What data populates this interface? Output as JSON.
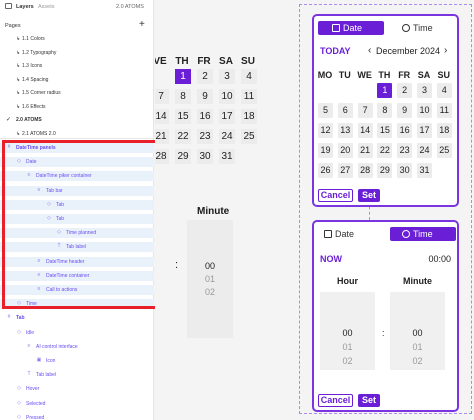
{
  "tabs": {
    "layers": "Layers",
    "assets": "Assets",
    "atoms": "2.0 ATOMS"
  },
  "pages": {
    "header": "Pages",
    "add": "+",
    "items": [
      {
        "label": "1.1 Colors"
      },
      {
        "label": "1.2 Typography"
      },
      {
        "label": "1.3 Icons"
      },
      {
        "label": "1.4 Spacing"
      },
      {
        "label": "1.5 Corner radius"
      },
      {
        "label": "1.6 Effects"
      },
      {
        "label": "2.0 ATOMS"
      },
      {
        "label": "2.1 ATOMS 2.0"
      }
    ],
    "current_mark": "✓"
  },
  "layers": [
    {
      "label": "DateTime panels",
      "icon": "#",
      "indent": 6,
      "sel": true,
      "bold": true
    },
    {
      "label": "Date",
      "icon": "◇",
      "indent": 16,
      "sel": true
    },
    {
      "label": "DateTime piker container",
      "icon": "≡",
      "indent": 26,
      "sel": true
    },
    {
      "label": "Tab bar",
      "icon": "≡",
      "indent": 36,
      "sel": true
    },
    {
      "label": "Tab",
      "icon": "◇",
      "indent": 46,
      "sel": true
    },
    {
      "label": "Tab",
      "icon": "◇",
      "indent": 46,
      "sel": true
    },
    {
      "label": "Time planned",
      "icon": "◇",
      "indent": 56,
      "sel": true
    },
    {
      "label": "Tab label",
      "icon": "T",
      "indent": 56,
      "sel": true
    },
    {
      "label": "DateTime header",
      "icon": "≡",
      "indent": 36,
      "sel": true
    },
    {
      "label": "DateTime container",
      "icon": "≡",
      "indent": 36,
      "sel": true
    },
    {
      "label": "Call to actions",
      "icon": "≡",
      "indent": 36,
      "sel": true
    },
    {
      "label": "Time",
      "icon": "◇",
      "indent": 16,
      "sel": true
    },
    {
      "label": "Tab",
      "icon": "#",
      "indent": 6,
      "sel": false,
      "bold": true
    },
    {
      "label": "Idle",
      "icon": "◇",
      "indent": 16,
      "sel": false
    },
    {
      "label": "AI control interface",
      "icon": "≡",
      "indent": 26,
      "sel": false
    },
    {
      "label": "Icon",
      "icon": "▣",
      "indent": 36,
      "sel": false
    },
    {
      "label": "Tab label",
      "icon": "T",
      "indent": 26,
      "sel": false
    },
    {
      "label": "Hover",
      "icon": "◇",
      "indent": 16,
      "sel": false
    },
    {
      "label": "Selected",
      "icon": "◇",
      "indent": 16,
      "sel": false
    },
    {
      "label": "Pressed",
      "icon": "◇",
      "indent": 16,
      "sel": false
    }
  ],
  "bg_calendar": {
    "heads": [
      "VE",
      "TH",
      "FR",
      "SA",
      "SU"
    ],
    "rows": [
      [
        "",
        "1",
        "2",
        "3",
        "4"
      ],
      [
        "7",
        "8",
        "9",
        "10",
        "11"
      ],
      [
        "14",
        "15",
        "16",
        "17",
        "18"
      ],
      [
        "21",
        "22",
        "23",
        "24",
        "25"
      ],
      [
        "28",
        "29",
        "30",
        "31",
        ""
      ]
    ],
    "minute_label": "Minute",
    "minute_values": [
      "00",
      "01",
      "02"
    ],
    "colon": ":"
  },
  "date_picker": {
    "tab_date": "Date",
    "tab_time": "Time",
    "today": "TODAY",
    "prev": "‹",
    "month": "December 2024",
    "next": "›",
    "weekdays": [
      "MO",
      "TU",
      "WE",
      "TH",
      "FR",
      "SA",
      "SU"
    ],
    "weeks": [
      [
        "",
        "",
        "",
        "1",
        "2",
        "3",
        "4"
      ],
      [
        "5",
        "6",
        "7",
        "8",
        "9",
        "10",
        "11"
      ],
      [
        "12",
        "13",
        "14",
        "15",
        "16",
        "17",
        "18"
      ],
      [
        "19",
        "20",
        "21",
        "22",
        "23",
        "24",
        "25"
      ],
      [
        "26",
        "27",
        "28",
        "29",
        "30",
        "31",
        ""
      ]
    ],
    "selected": "1",
    "cancel": "Cancel",
    "set": "Set"
  },
  "time_picker": {
    "tab_date": "Date",
    "tab_time": "Time",
    "now": "NOW",
    "clock": "00:00",
    "hour_label": "Hour",
    "minute_label": "Minute",
    "hours": [
      "00",
      "01",
      "02"
    ],
    "minutes": [
      "00",
      "01",
      "02"
    ],
    "colon": ":",
    "cancel": "Cancel",
    "set": "Set"
  },
  "colors": {
    "accent": "#6a1fd6",
    "selection_frame": "#e8202a",
    "layer_text": "#6a4cf0"
  }
}
